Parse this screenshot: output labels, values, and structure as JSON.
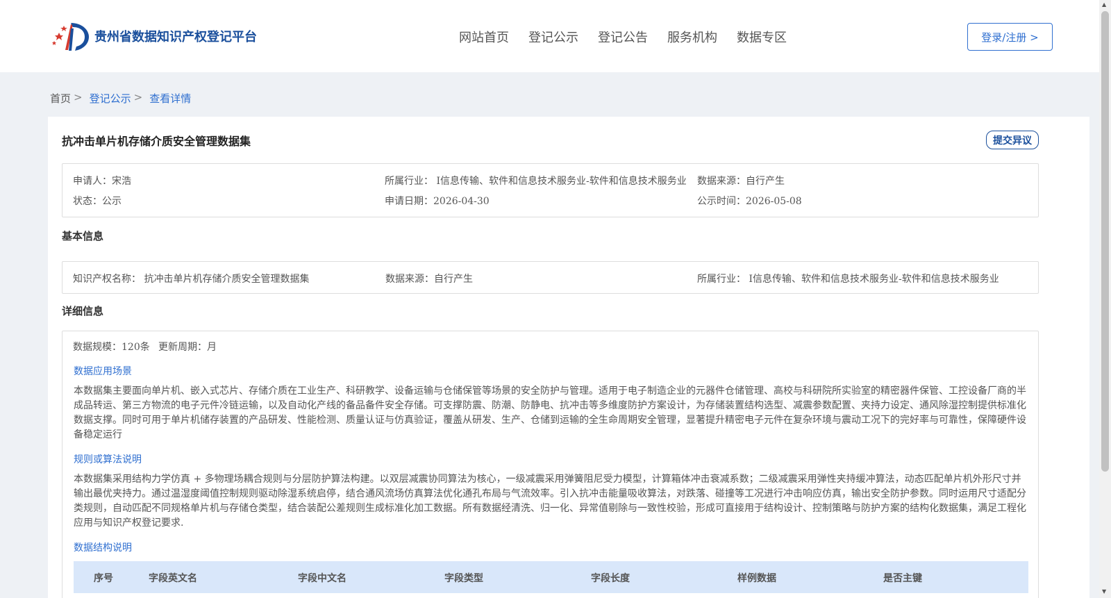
{
  "header": {
    "site_title": "贵州省数据知识产权登记平台",
    "nav": [
      "网站首页",
      "登记公示",
      "登记公告",
      "服务机构",
      "数据专区"
    ],
    "login_label": "登录/注册 >"
  },
  "breadcrumb": {
    "home": "首页",
    "list": "登记公示",
    "current": "查看详情",
    "sep": ">"
  },
  "record": {
    "title": "抗冲击单片机存储介质安全管理数据集",
    "objection_label": "提交异议",
    "applicant": "申请人：宋浩",
    "industry": "所属行业： I信息传输、软件和信息技术服务业-软件和信息技术服务业",
    "data_source": "数据来源：自行产生",
    "status": "状态：公示",
    "apply_date": "申请日期：2026-04-30",
    "publicity_date": "公示时间：2026-05-08"
  },
  "basic": {
    "section_title": "基本信息",
    "ip_name": "知识产权名称： 抗冲击单片机存储介质安全管理数据集",
    "data_source": "数据来源：自行产生",
    "industry": "所属行业： I信息传输、软件和信息技术服务业-软件和信息技术服务业"
  },
  "detail": {
    "section_title": "详细信息",
    "scale": "数据规模：120条",
    "update_cycle": "更新周期：月",
    "scenario_title": "数据应用场景",
    "scenario_text": "本数据集主要面向单片机、嵌入式芯片、存储介质在工业生产、科研教学、设备运输与仓储保管等场景的安全防护与管理。适用于电子制造企业的元器件仓储管理、高校与科研院所实验室的精密器件保管、工控设备厂商的半成品转运、第三方物流的电子元件冷链运输，以及自动化产线的备品备件安全存储。可支撑防震、防潮、防静电、抗冲击等多维度防护方案设计，为存储装置结构选型、减震参数配置、夹持力设定、通风除湿控制提供标准化数据支撑。同时可用于单片机储存装置的产品研发、性能检测、质量认证与仿真验证，覆盖从研发、生产、仓储到运输的全生命周期安全管理，显著提升精密电子元件在复杂环境与震动工况下的完好率与可靠性，保障硬件设备稳定运行",
    "rules_title": "规则或算法说明",
    "rules_text": "本数据集采用结构力学仿真 + 多物理场耦合规则与分层防护算法构建。以双层减震协同算法为核心，一级减震采用弹簧阻尼受力模型，计算箱体冲击衰减系数；二级减震采用弹性夹持缓冲算法，动态匹配单片机外形尺寸并输出最优夹持力。通过温湿度阈值控制规则驱动除湿系统启停，结合通风流场仿真算法优化通孔布局与气流效率。引入抗冲击能量吸收算法，对跌落、碰撞等工况进行冲击响应仿真，输出安全防护参数。同时运用尺寸适配分类规则，自动匹配不同规格单片机与存储仓类型，结合装配公差规则生成标准化加工数据。所有数据经清洗、归一化、异常值剔除与一致性校验，形成可直接用于结构设计、控制策略与防护方案的结构化数据集，满足工程化应用与知识产权登记要求.",
    "structure_title": "数据结构说明",
    "table_headers": [
      "序号",
      "字段英文名",
      "字段中文名",
      "字段类型",
      "字段长度",
      "样例数据",
      "是否主键"
    ]
  },
  "colors": {
    "brand": "#1a4f9c",
    "link": "#2f6fd0",
    "table_header_bg": "#d9e7fa",
    "page_bg": "#eef1f5"
  },
  "icons": [
    "site-logo-icon",
    "scroll-up-arrow-icon",
    "scroll-down-arrow-icon"
  ]
}
